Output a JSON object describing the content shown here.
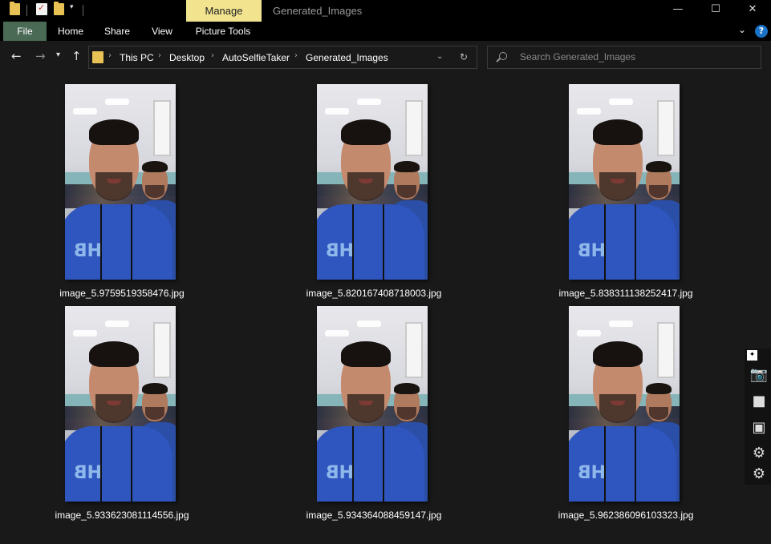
{
  "titlebar": {
    "context_tab": "Manage",
    "window_title": "Generated_Images",
    "controls": {
      "minimize": "—",
      "maximize": "☐",
      "close": "✕"
    }
  },
  "ribbon": {
    "tabs": [
      "File",
      "Home",
      "Share",
      "View",
      "Picture Tools"
    ],
    "help": "?"
  },
  "address": {
    "breadcrumbs": [
      "This PC",
      "Desktop",
      "AutoSelfieTaker",
      "Generated_Images"
    ]
  },
  "search": {
    "placeholder": "Search Generated_Images"
  },
  "files": [
    {
      "name": "image_5.9759519358476.jpg"
    },
    {
      "name": "image_5.820167408718003.jpg"
    },
    {
      "name": "image_5.838311138252417.jpg"
    },
    {
      "name": "image_5.933623081114556.jpg"
    },
    {
      "name": "image_5.934364088459147.jpg"
    },
    {
      "name": "image_5.962386096103323.jpg"
    }
  ],
  "colors": {
    "background": "#191919",
    "manage_tab": "#f2e48f",
    "file_tab": "#4a6a55",
    "folder": "#e8c254",
    "help": "#1a73c7"
  },
  "sidetool_icons": [
    "pin-icon",
    "camera-icon",
    "video-icon",
    "gallery-icon",
    "gear-icon",
    "gear-icon"
  ]
}
